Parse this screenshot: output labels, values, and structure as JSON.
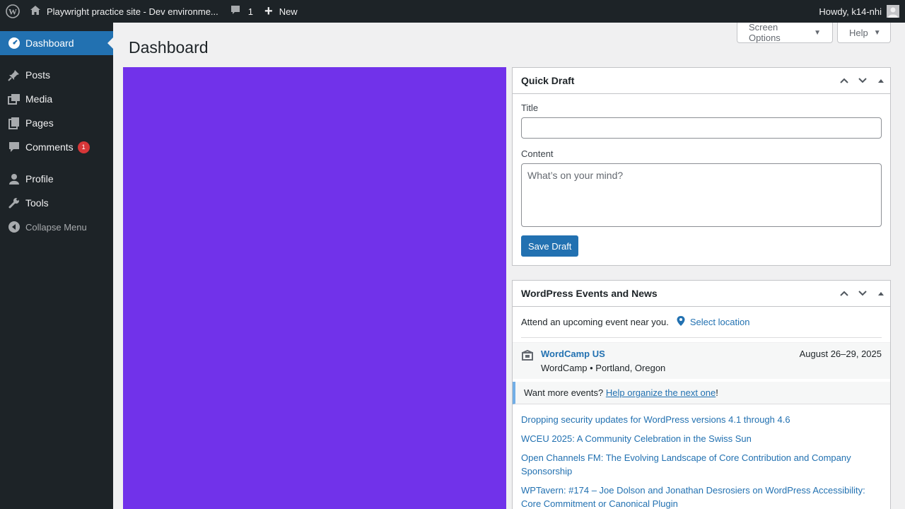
{
  "adminbar": {
    "site_title": "Playwright practice site - Dev environme...",
    "comments_count": "1",
    "new_label": "New",
    "howdy": "Howdy, k14-nhi"
  },
  "sidebar": {
    "items": [
      {
        "label": "Dashboard",
        "icon": "dashboard-icon"
      },
      {
        "label": "Posts",
        "icon": "pin-icon"
      },
      {
        "label": "Media",
        "icon": "media-icon"
      },
      {
        "label": "Pages",
        "icon": "pages-icon"
      },
      {
        "label": "Comments",
        "icon": "comment-icon",
        "badge": "1"
      },
      {
        "label": "Profile",
        "icon": "user-icon"
      },
      {
        "label": "Tools",
        "icon": "wrench-icon"
      }
    ],
    "collapse_label": "Collapse Menu"
  },
  "header": {
    "page_title": "Dashboard",
    "screen_options": "Screen Options",
    "help": "Help"
  },
  "quick_draft": {
    "title": "Quick Draft",
    "title_label": "Title",
    "title_value": "",
    "content_label": "Content",
    "content_placeholder": "What’s on your mind?",
    "save_label": "Save Draft"
  },
  "events": {
    "title": "WordPress Events and News",
    "intro": "Attend an upcoming event near you.",
    "select_location": "Select location",
    "event_name": "WordCamp US",
    "event_location": "WordCamp • Portland, Oregon",
    "event_date": "August 26–29, 2025",
    "more_prefix": "Want more events?",
    "more_link": "Help organize the next one",
    "more_suffix": "!",
    "news": [
      "Dropping security updates for WordPress versions 4.1 through 4.6",
      "WCEU 2025: A Community Celebration in the Swiss Sun",
      "Open Channels FM: The Evolving Landscape of Core Contribution and Company Sponsorship",
      "WPTavern: #174 – Joe Dolson and Jonathan Desrosiers on WordPress Accessibility: Core Commitment or Canonical Plugin"
    ]
  },
  "colors": {
    "adminbar_bg": "#1d2327",
    "accent": "#2271b1",
    "content_block": "#7132ea",
    "badge": "#d63638"
  }
}
